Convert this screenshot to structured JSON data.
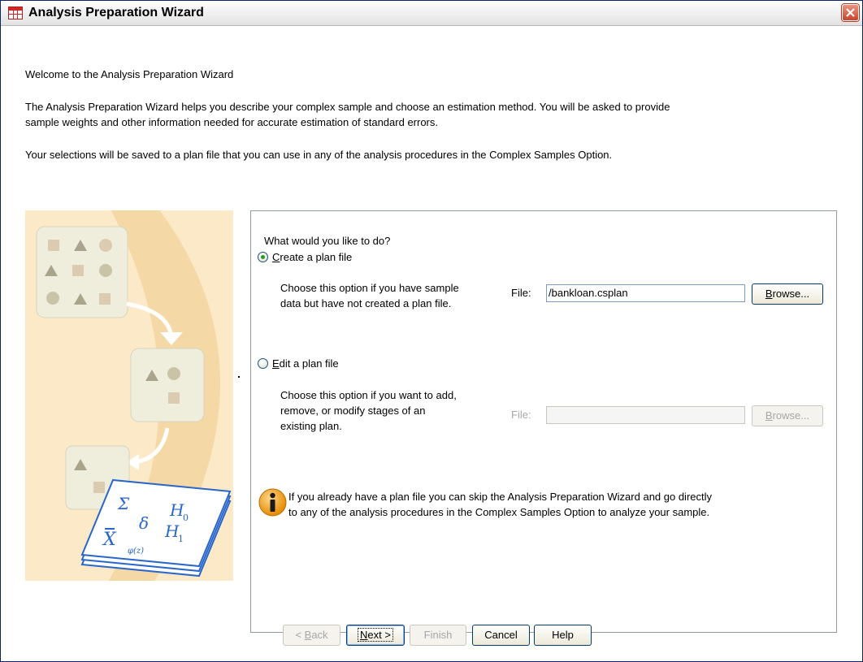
{
  "window": {
    "title": "Analysis Preparation Wizard",
    "icon": "spreadsheet-icon",
    "close_icon": "close-icon"
  },
  "intro": {
    "heading": "Welcome to the Analysis Preparation Wizard",
    "paragraph1_line1": "The Analysis Preparation Wizard helps you describe your complex sample and choose an estimation method. You will be asked to provide",
    "paragraph1_line2": "sample weights and other information needed for accurate estimation of standard errors.",
    "paragraph2": "Your selections will be saved to a plan file that you can use in any of the analysis procedures in the Complex Samples Option."
  },
  "illustration": {
    "icon": "wizard-illustration",
    "symbols": [
      "Σ",
      "H",
      "0",
      "δ",
      "H",
      "1",
      "X",
      "φ(z)"
    ]
  },
  "panel": {
    "question": "What would you like to do?",
    "create_option": {
      "label_mnemonic": "C",
      "label_rest": "reate a plan file",
      "selected": true,
      "desc_line1": "Choose this option if you have sample",
      "desc_line2": "data but have not created a plan file.",
      "file_label": "File:",
      "file_value": "/bankloan.csplan",
      "browse_mnemonic": "B",
      "browse_rest": "rowse..."
    },
    "edit_option": {
      "label_mnemonic": "E",
      "label_rest": "dit a plan file",
      "selected": false,
      "desc_line1": "Choose this option if you want to add,",
      "desc_line2": "remove, or modify stages of an",
      "desc_line3": "existing plan.",
      "file_label": "File:",
      "file_value": "",
      "browse_mnemonic": "B",
      "browse_rest": "rowse..."
    },
    "info": {
      "icon": "info-icon",
      "line1": "If you already have a plan file you can skip the Analysis Preparation Wizard and go directly",
      "line2": "to any of the analysis procedures in the Complex Samples Option to analyze your sample."
    }
  },
  "buttons": {
    "back_prefix": "< ",
    "back_mnemonic": "B",
    "back_rest": "ack",
    "next_mnemonic": "N",
    "next_rest": "ext >",
    "finish": "Finish",
    "cancel": "Cancel",
    "help": "Help"
  },
  "colors": {
    "title_text": "#000000",
    "illustration_bg": "#fbe9c7",
    "swoosh": "#f4d9a6",
    "card": "#efeedd",
    "shape": "#c9c4a8",
    "accent_blue": "#2a66c9",
    "close_red": "#c8462d",
    "radio_selected": "#2f9a22"
  }
}
